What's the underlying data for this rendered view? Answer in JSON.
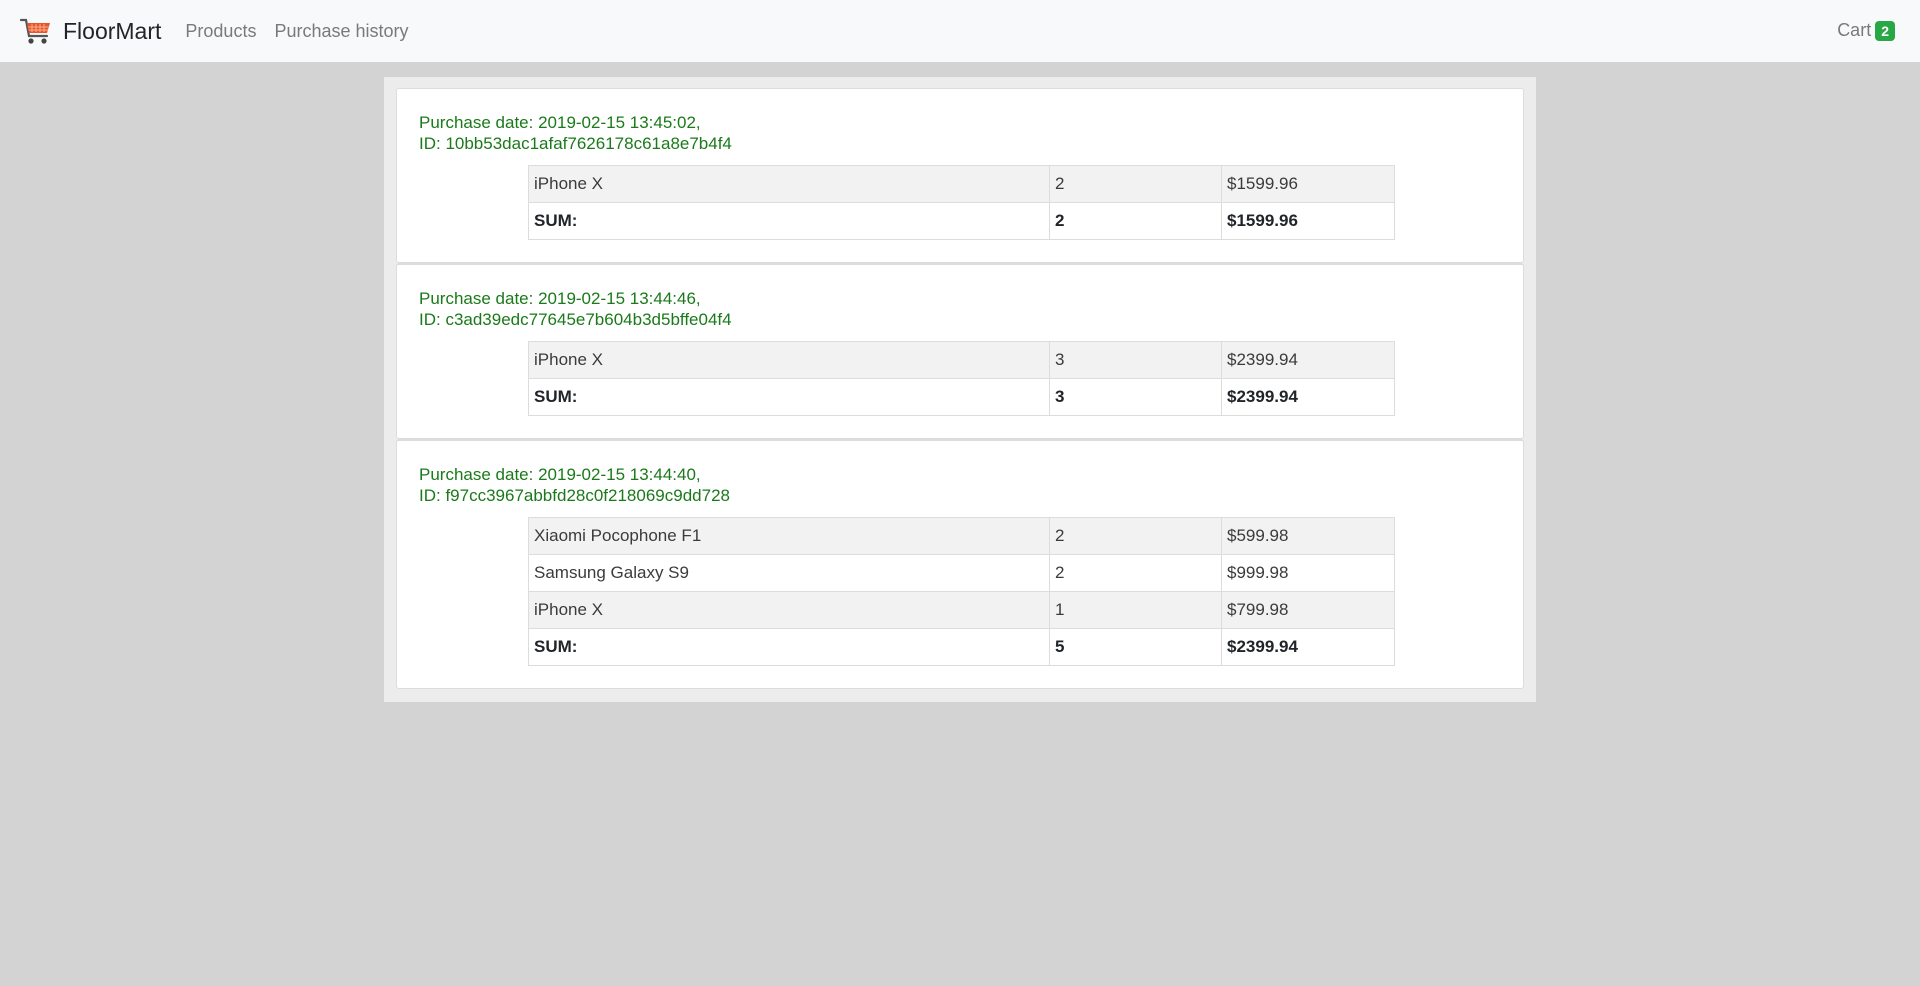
{
  "navbar": {
    "brand": "FloorMart",
    "links": [
      "Products",
      "Purchase history"
    ],
    "cart_label": "Cart",
    "cart_count": "2"
  },
  "orders": [
    {
      "date_line": "Purchase date: 2019-02-15 13:45:02,",
      "id_line": "ID: 10bb53dac1afaf7626178c61a8e7b4f4",
      "items": [
        {
          "name": "iPhone X",
          "qty": "2",
          "price": "$1599.96"
        }
      ],
      "sum_label": "SUM:",
      "sum_qty": "2",
      "sum_price": "$1599.96"
    },
    {
      "date_line": "Purchase date: 2019-02-15 13:44:46,",
      "id_line": "ID: c3ad39edc77645e7b604b3d5bffe04f4",
      "items": [
        {
          "name": "iPhone X",
          "qty": "3",
          "price": "$2399.94"
        }
      ],
      "sum_label": "SUM:",
      "sum_qty": "3",
      "sum_price": "$2399.94"
    },
    {
      "date_line": "Purchase date: 2019-02-15 13:44:40,",
      "id_line": "ID: f97cc3967abbfd28c0f218069c9dd728",
      "items": [
        {
          "name": "Xiaomi Pocophone F1",
          "qty": "2",
          "price": "$599.98"
        },
        {
          "name": "Samsung Galaxy S9",
          "qty": "2",
          "price": "$999.98"
        },
        {
          "name": "iPhone X",
          "qty": "1",
          "price": "$799.98"
        }
      ],
      "sum_label": "SUM:",
      "sum_qty": "5",
      "sum_price": "$2399.94"
    }
  ]
}
